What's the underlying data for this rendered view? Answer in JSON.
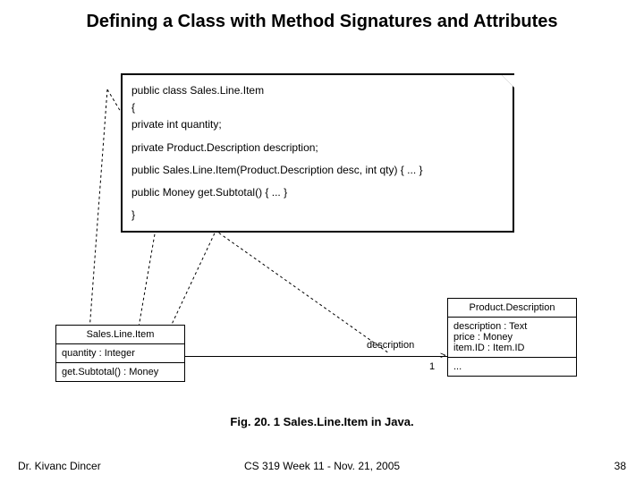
{
  "title": "Defining a Class with Method Signatures and Attributes",
  "code": {
    "l1": "public class Sales.Line.Item",
    "l2": "{",
    "l3": "private int quantity;",
    "l4": "private Product.Description description;",
    "l5": "public Sales.Line.Item(Product.Description desc, int qty) { ... }",
    "l6": "public Money get.Subtotal() { ... }",
    "l7": "}"
  },
  "uml_sli": {
    "name": "Sales.Line.Item",
    "attr1": "quantity : Integer",
    "op1": "get.Subtotal() : Money"
  },
  "uml_pd": {
    "name": "Product.Description",
    "attr1": "description : Text",
    "attr2": "price : Money",
    "attr3": "item.ID : Item.ID",
    "op1": "..."
  },
  "assoc": {
    "label": "description",
    "mult": "1",
    "arrow": ">"
  },
  "caption": "Fig. 20. 1 Sales.Line.Item in Java.",
  "footer": {
    "left": "Dr. Kivanc Dincer",
    "center": "CS 319 Week 11 - Nov. 21, 2005",
    "right": "38"
  }
}
